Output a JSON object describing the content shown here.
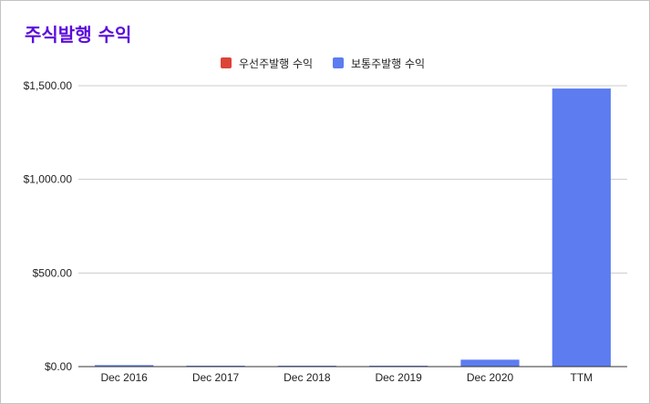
{
  "chart_data": {
    "type": "bar",
    "title": "주식발행 수익",
    "xlabel": "",
    "ylabel": "",
    "categories": [
      "Dec 2016",
      "Dec 2017",
      "Dec 2018",
      "Dec 2019",
      "Dec 2020",
      "TTM"
    ],
    "series": [
      {
        "name": "우선주발행 수익",
        "color": "#db4437",
        "values": [
          0,
          0,
          0,
          0,
          0,
          0
        ]
      },
      {
        "name": "보통주발행 수익",
        "color": "#5c7cf0",
        "values": [
          8,
          4,
          4,
          4,
          37,
          1485
        ]
      }
    ],
    "ylim": [
      0,
      1500
    ],
    "yticks": [
      {
        "value": 0,
        "label": "$0.00"
      },
      {
        "value": 500,
        "label": "$500.00"
      },
      {
        "value": 1000,
        "label": "$1,000.00"
      },
      {
        "value": 1500,
        "label": "$1,500.00"
      }
    ],
    "grid": true,
    "legend_position": "top"
  },
  "colors": {
    "title": "#5b0bdc",
    "gridline": "#cccccc",
    "baseline": "#333333"
  }
}
